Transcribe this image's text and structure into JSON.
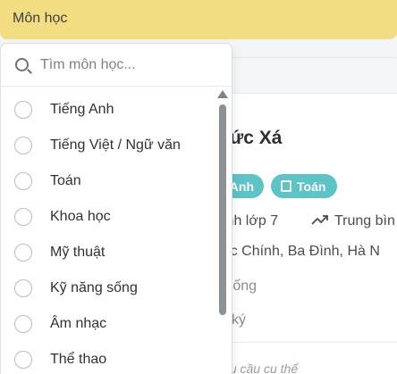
{
  "header": {
    "title": "Môn học"
  },
  "search": {
    "placeholder": "Tìm môn học...",
    "icon": "search-icon"
  },
  "options": [
    {
      "label": "Tiếng Anh",
      "selected": false
    },
    {
      "label": "Tiếng Việt / Ngữ văn",
      "selected": false
    },
    {
      "label": "Toán",
      "selected": false
    },
    {
      "label": "Khoa học",
      "selected": false
    },
    {
      "label": "Mỹ thuật",
      "selected": false
    },
    {
      "label": "Kỹ năng sống",
      "selected": false
    },
    {
      "label": "Âm nhạc",
      "selected": false
    },
    {
      "label": "Thể thao",
      "selected": false
    }
  ],
  "card": {
    "name": "ức Xá",
    "tags": [
      "Anh",
      "Toán"
    ],
    "grade": "inh lớp 7",
    "level": "Trung bìn",
    "address": "ức Chính, Ba Đình, Hà N",
    "schedule": "rống",
    "registration": "ký",
    "requirement": "Không có yêu cầu cụ thể"
  },
  "colors": {
    "header_bg": "#f3dd82",
    "chip_bg": "#5cc3c7",
    "scroll_thumb": "#8d9095"
  }
}
